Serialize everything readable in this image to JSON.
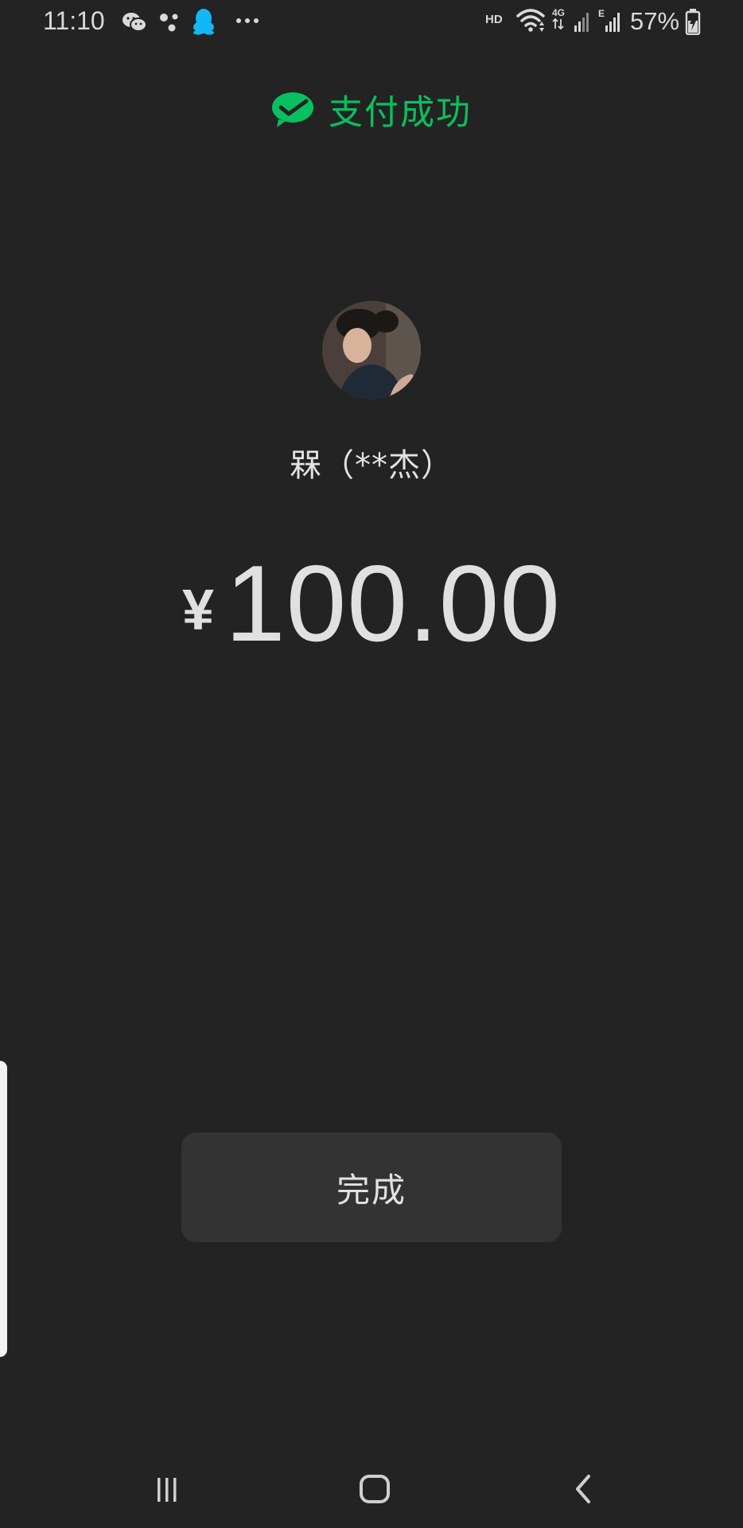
{
  "status_bar": {
    "time": "11:10",
    "battery": "57%",
    "network_label": "HD",
    "notification_icons": [
      "wechat-icon",
      "dots-app-icon",
      "qq-icon",
      "more-icon"
    ],
    "system_icons": [
      "wifi-icon",
      "signal-4g-icon",
      "signal-e-icon",
      "battery-charging-icon"
    ]
  },
  "header": {
    "title": "支付成功",
    "accent_color": "#07c160"
  },
  "payee": {
    "name": "槑（**杰）"
  },
  "payment": {
    "currency": "¥",
    "amount": "100.00"
  },
  "actions": {
    "done_label": "完成"
  },
  "nav": {
    "buttons": [
      "recents-icon",
      "home-icon",
      "back-icon"
    ]
  }
}
